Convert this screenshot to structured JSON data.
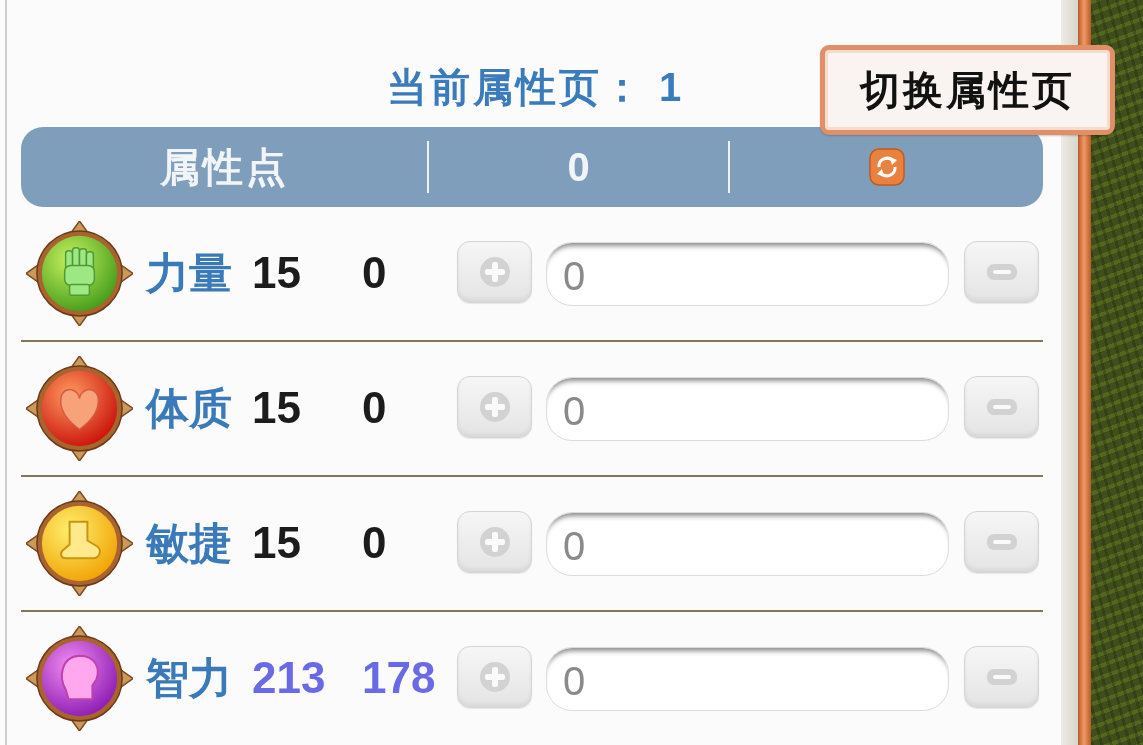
{
  "page_indicator": {
    "label": "当前属性页：",
    "value": "1"
  },
  "switch_page_button": {
    "label": "切换属性页"
  },
  "points_header": {
    "label": "属性点",
    "value": "0"
  },
  "attributes": [
    {
      "name": "力量",
      "base": "15",
      "bonus": "0",
      "highlighted": false,
      "input": {
        "value": "0"
      }
    },
    {
      "name": "体质",
      "base": "15",
      "bonus": "0",
      "highlighted": false,
      "input": {
        "value": "0"
      }
    },
    {
      "name": "敏捷",
      "base": "15",
      "bonus": "0",
      "highlighted": false,
      "input": {
        "value": "0"
      }
    },
    {
      "name": "智力",
      "base": "213",
      "bonus": "178",
      "highlighted": true,
      "input": {
        "value": "0"
      }
    }
  ]
}
